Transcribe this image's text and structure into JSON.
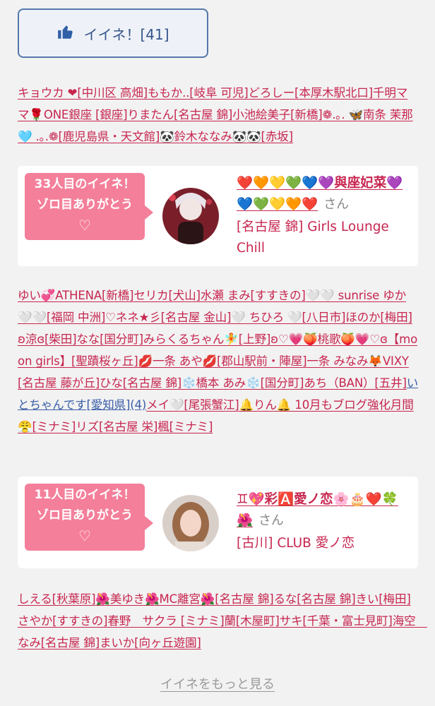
{
  "like_button": {
    "label": "イイネ！[41]"
  },
  "list1": [
    {
      "text": "キョウカ ❤[中川区 高畑]"
    },
    {
      "text": "ももか..[岐阜 可児]"
    },
    {
      "text": "どろしー[本厚木駅北口]"
    },
    {
      "text": "千明ママ🌹ONE銀座 [銀座]"
    },
    {
      "text": "りまたん[名古屋 錦]"
    },
    {
      "text": "小池絵美子[新橋]"
    },
    {
      "text": "❁.｡. 🦋南条 茉那🩵 .｡.❁[鹿児島県・天文館]"
    },
    {
      "text": "🐼鈴木ななみ🐼🐼[赤坂]"
    }
  ],
  "card1": {
    "bubble_line1": "33人目のイイネ！",
    "bubble_line2": "ゾロ目ありがとう",
    "bubble_heart": "♡",
    "name": "❤️🧡💛💚💙💜與座妃菜💜💙💚💛🧡❤️",
    "san": "さん",
    "shop": "[名古屋 錦] Girls Lounge Chill"
  },
  "list2": [
    {
      "text": "ゆい💞ATHENA[新橋]"
    },
    {
      "text": "セリカ[犬山]"
    },
    {
      "text": "水瀬 まみ[すすきの]"
    },
    {
      "text": "🤍🤍 sunrise ゆか 🤍🤍[福岡 中洲]"
    },
    {
      "text": "♡ネネ★彡[名古屋 金山]"
    },
    {
      "text": "🤍 ちひろ 🤍[八日市]"
    },
    {
      "text": "ほのか[梅田]"
    },
    {
      "text": "ʚ涼ɞ[柴田]"
    },
    {
      "text": "なな[国分町]"
    },
    {
      "text": "みらくるちゃん🧚[上野]"
    },
    {
      "text": "ʚ♡💗🍑桃歌🍑💗♡ɞ【moon girls】[聖蹟桜ヶ丘]"
    },
    {
      "text": "💋一条 あや💋[郡山駅前・陣屋]"
    },
    {
      "text": "一条 みなみ🦊VIXY[名古屋 藤が丘]"
    },
    {
      "text": "ひな[名古屋 錦]"
    },
    {
      "text": "❄️橋本 あみ❄️[国分町]"
    },
    {
      "text": "あち（BAN）[五井]"
    },
    {
      "text": "いとちゃんです[愛知県](4)",
      "blue": true
    },
    {
      "text": "メイ🤍[尾張蟹江]"
    },
    {
      "text": "🔔りん🔔 10月もブログ強化月間😤[ミナミ]"
    },
    {
      "text": "リズ[名古屋 栄]"
    },
    {
      "text": "楓[ミナミ]"
    }
  ],
  "card2": {
    "bubble_line1": "11人目のイイネ！",
    "bubble_line2": "ゾロ目ありがとう",
    "bubble_heart": "♡",
    "name": "♊💖彩🅰️愛ノ恋🌸🎂❤️🍀🌺",
    "san": "さん",
    "shop": "[古川] CLUB 愛ノ恋"
  },
  "list3": [
    {
      "text": "しえる[秋葉原]"
    },
    {
      "text": "🌺美ゆき🌺MC離宮🌺[名古屋 錦]"
    },
    {
      "text": "るな[名古屋 錦]"
    },
    {
      "text": "きい[梅田]"
    },
    {
      "text": "さやか[すすきの]"
    },
    {
      "text": "春野　サクラ [ミナミ]"
    },
    {
      "text": "蘭[木屋町]"
    },
    {
      "text": "サキ[千葉・富士見町]"
    },
    {
      "text": "海空　なみ[名古屋 錦]"
    },
    {
      "text": "まいか[向ヶ丘遊園]"
    }
  ],
  "more_link": "イイネをもっと見る",
  "colors": {
    "accent": "#c7264f",
    "bubble": "#f47f9a",
    "button_border": "#5577aa"
  }
}
